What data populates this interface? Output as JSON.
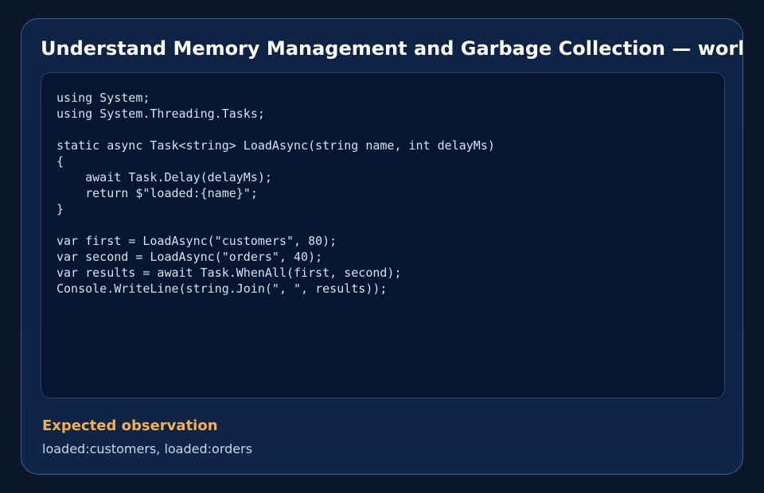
{
  "card": {
    "title": "Understand Memory Management and Garbage Collection — worked example"
  },
  "code": {
    "lines": [
      "using System;",
      "using System.Threading.Tasks;",
      "",
      "static async Task<string> LoadAsync(string name, int delayMs)",
      "{",
      "    await Task.Delay(delayMs);",
      "    return $\"loaded:{name}\";",
      "}",
      "",
      "var first = LoadAsync(\"customers\", 80);",
      "var second = LoadAsync(\"orders\", 40);",
      "var results = await Task.WhenAll(first, second);",
      "Console.WriteLine(string.Join(\", \", results));"
    ]
  },
  "observation": {
    "heading": "Expected observation",
    "text": "loaded:customers, loaded:orders"
  },
  "colors": {
    "background": "#0b1628",
    "card_border": "#3e5f91",
    "code_background": "#061630",
    "accent_heading": "#f3b04b",
    "title": "#ffffff"
  }
}
